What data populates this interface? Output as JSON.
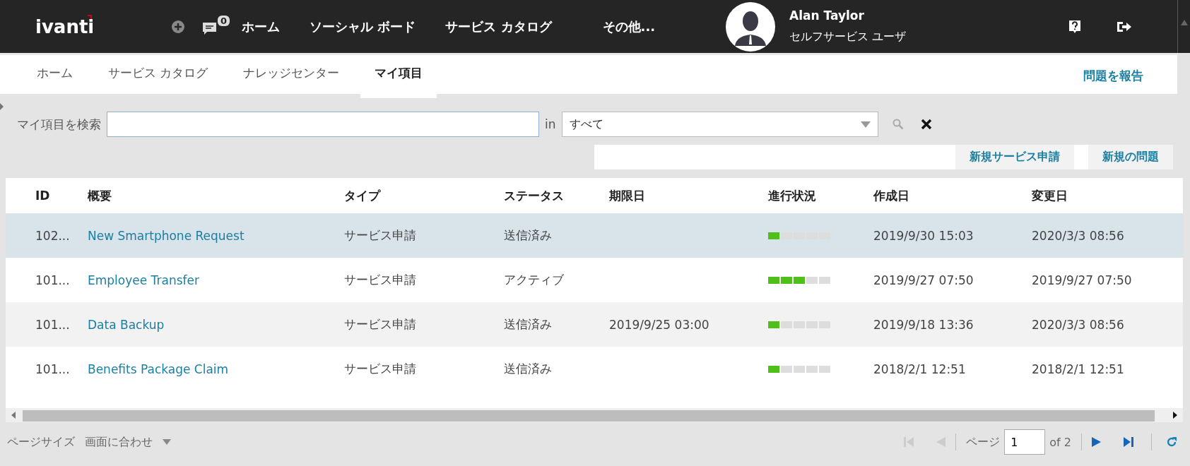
{
  "header": {
    "logo": "ivanti",
    "notification_count": "0",
    "nav": [
      "ホーム",
      "ソーシャル ボード",
      "サービス カタログ",
      "その他..."
    ],
    "user": {
      "name": "Alan Taylor",
      "role": "セルフサービス ユーザ"
    }
  },
  "tabs": [
    {
      "label": "ホーム",
      "selected": false
    },
    {
      "label": "サービス カタログ",
      "selected": false
    },
    {
      "label": "ナレッジセンター",
      "selected": false
    },
    {
      "label": "マイ項目",
      "selected": true
    }
  ],
  "report_link": "問題を報告",
  "search": {
    "label": "マイ項目を検索",
    "in_label": "in",
    "scope": "すべて"
  },
  "actions": [
    "新規サービス申請",
    "新規の問題"
  ],
  "table": {
    "columns": [
      "ID",
      "概要",
      "タイプ",
      "ステータス",
      "期限日",
      "進行状況",
      "作成日",
      "変更日"
    ],
    "rows": [
      {
        "id": "102...",
        "summary": "New Smartphone Request",
        "type": "サービス申請",
        "status": "送信済み",
        "progress": {
          "level": 0.2
        },
        "created": "2019/9/30 15:03",
        "modified": "2020/3/3 08:56",
        "selected": true
      },
      {
        "id": "101...",
        "summary": "Employee Transfer",
        "type": "サービス申請",
        "status": "アクティブ",
        "progress": {
          "level": 0.6
        },
        "created": "2019/9/27 07:50",
        "modified": "2019/9/27 07:50",
        "selected": false
      },
      {
        "id": "101...",
        "summary": "Data Backup",
        "type": "サービス申請",
        "status": "送信済み",
        "due": "2019/9/25 03:00",
        "progress": {
          "level": 0.2
        },
        "created": "2019/9/18 13:36",
        "modified": "2020/3/3 08:56",
        "selected": false
      },
      {
        "id": "101...",
        "summary": "Benefits Package Claim",
        "type": "サービス申請",
        "status": "送信済み",
        "progress": {
          "level": 0.2
        },
        "created": "2018/2/1 12:51",
        "modified": "2018/2/1 12:51",
        "selected": false
      }
    ]
  },
  "pager": {
    "page_size_label": "ページサイズ",
    "page_size": "画面に合わせ",
    "page_label": "ページ",
    "page": "1",
    "of_label": "of 2"
  }
}
